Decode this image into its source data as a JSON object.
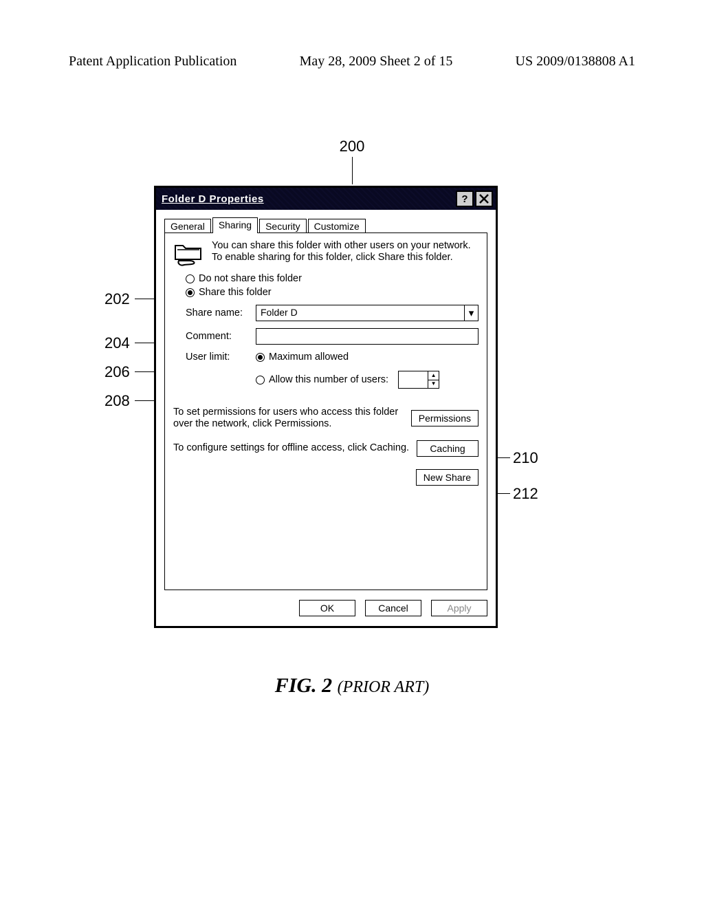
{
  "header": {
    "left": "Patent Application Publication",
    "center": "May 28, 2009  Sheet 2 of 15",
    "right": "US 2009/0138808 A1"
  },
  "figure_number": "200",
  "dialog": {
    "title": "Folder D Properties",
    "tabs": {
      "general": "General",
      "sharing": "Sharing",
      "security": "Security",
      "customize": "Customize"
    },
    "intro": "You can share this folder with other users on your network.  To enable sharing for this folder, click Share this folder.",
    "radio_do_not_share": "Do not share this folder",
    "radio_share": "Share this folder",
    "share_name_label": "Share name:",
    "share_name_value": "Folder D",
    "comment_label": "Comment:",
    "userlimit_label": "User limit:",
    "userlimit_max": "Maximum allowed",
    "userlimit_allow": "Allow this number of users:",
    "permissions_text": "To set permissions for users who access this folder over the network, click Permissions.",
    "permissions_btn": "Permissions",
    "caching_text": "To configure settings for offline access, click Caching.",
    "caching_btn": "Caching",
    "newshare_btn": "New Share",
    "ok": "OK",
    "cancel": "Cancel",
    "apply": "Apply"
  },
  "callouts": {
    "c202": "202",
    "c204": "204",
    "c206": "206",
    "c208": "208",
    "c210": "210",
    "c212": "212"
  },
  "caption": {
    "fig": "FIG. 2",
    "prior": "(PRIOR ART)"
  }
}
